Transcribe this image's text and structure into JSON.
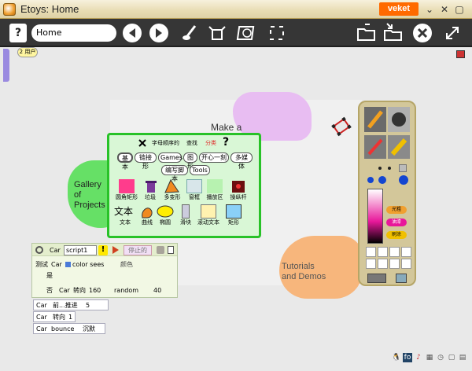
{
  "window": {
    "title": "Etoys: Home",
    "user": "veket",
    "controls": [
      "⌄",
      "✕",
      "▢",
      "✕"
    ]
  },
  "toolbar": {
    "help_label": "?",
    "project_name": "Home"
  },
  "world": {
    "flap_top_label": "2 用户",
    "make_a": "Make a",
    "gallery_of_projects": [
      "Gallery",
      "of",
      "Projects"
    ],
    "tutorials_and_demos": [
      "Tutorials",
      "and Demos"
    ]
  },
  "palette": {
    "header": {
      "alpha_label": "字母顺序的",
      "find_label": "查找",
      "category_label": "分类",
      "help_label": "?"
    },
    "tabs_row1": [
      "基本",
      "链接形",
      "Games",
      "图形",
      "开心一刻",
      "多媒体"
    ],
    "tabs_row2": [
      "编写脚本",
      "Tools"
    ],
    "items_row1": [
      "圆角矩形",
      "垃圾",
      "多变形",
      "窗框",
      "播放区",
      "操纵杆"
    ],
    "text_tile": "文本",
    "items_row2": [
      "文本",
      "曲线",
      "椭圆",
      "滑块",
      "滚动文本",
      "矩形"
    ]
  },
  "script": {
    "player": "Car",
    "name": "script1",
    "status": "停止的",
    "test_label": "测试",
    "color_sees": "color sees",
    "color_sees_val": "颜色",
    "yes_label": "是",
    "no_label": "否",
    "turn_label": "转向",
    "turn_value": "160",
    "random_label": "random",
    "random_value": "40"
  },
  "tiles": [
    {
      "player": "Car",
      "command": "前...推进",
      "value": "5"
    },
    {
      "player": "Car",
      "command": "转向",
      "value": "1"
    },
    {
      "player": "Car",
      "command": "bounce",
      "value": "沉默"
    }
  ],
  "supplies": {
    "colors": {
      "pink": "#e8189a",
      "yellow": "#f0c000",
      "blue": "#1446d0",
      "orange": "#f0a030"
    },
    "pills": [
      "光粗",
      "油漆",
      "刷涂"
    ]
  },
  "colors": {
    "accent_green": "#28c228",
    "titlebar_user_bg": "#ff6a00",
    "toolbar_bg": "#363636"
  }
}
